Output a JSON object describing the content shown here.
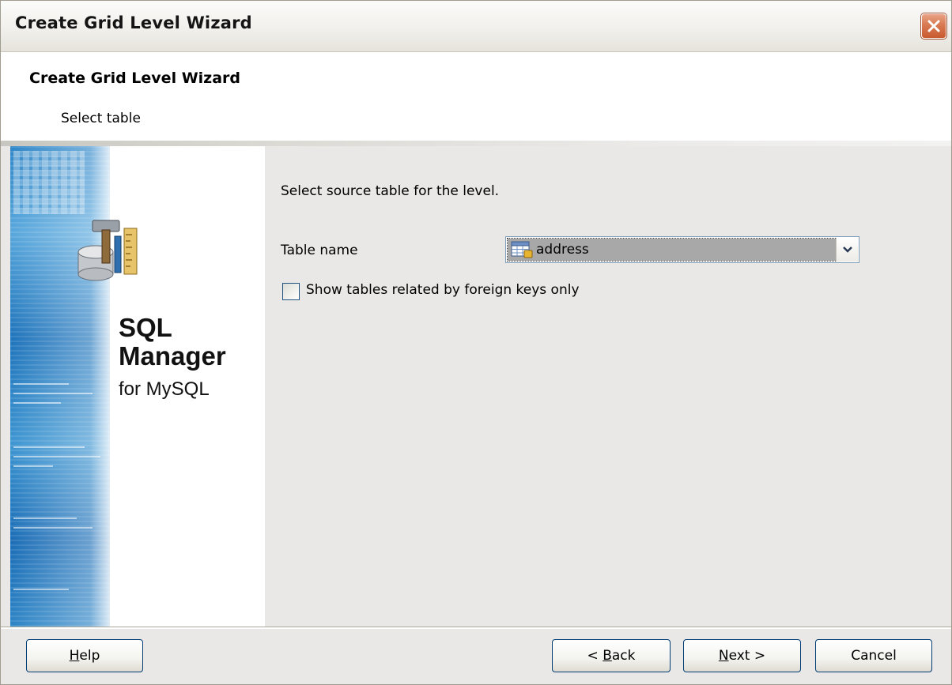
{
  "window": {
    "title": "Create Grid Level Wizard"
  },
  "header": {
    "title": "Create Grid Level Wizard",
    "subtitle": "Select table"
  },
  "side_panel": {
    "brand_line1": "SQL",
    "brand_line2": "Manager",
    "brand_line3": "for MySQL",
    "icon": "database-tools-icon"
  },
  "main": {
    "instruction": "Select source table for the level.",
    "table_name_label": "Table name",
    "table_name_value": "address",
    "table_icon": "table-icon",
    "checkbox_label": "Show tables related by foreign keys only",
    "checkbox_checked": false
  },
  "footer": {
    "help": {
      "mnemonic": "H",
      "rest": "elp"
    },
    "back": {
      "prefix": "< ",
      "mnemonic": "B",
      "rest": "ack"
    },
    "next": {
      "mnemonic": "N",
      "rest": "ext >"
    },
    "cancel": "Cancel"
  },
  "colors": {
    "dialog_bg": "#e9e8e6",
    "header_bg": "#ffffff",
    "close_button": "#d97a52",
    "selection_bg": "#a8a8a8",
    "button_border": "#003c74"
  }
}
